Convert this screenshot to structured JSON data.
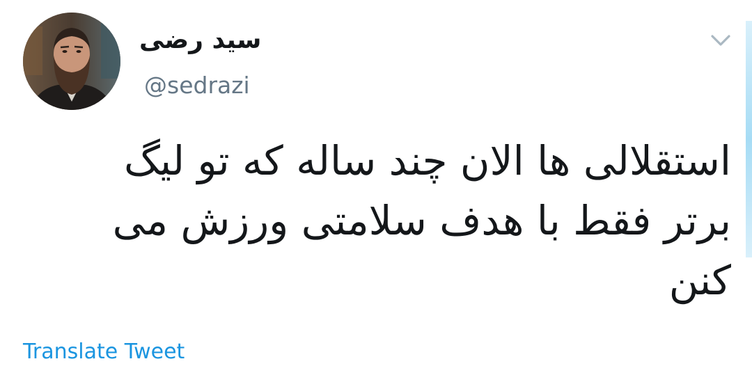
{
  "tweet": {
    "author": {
      "display_name": "سید رضی",
      "handle": "@sedrazi",
      "avatar_icon": "profile-photo"
    },
    "menu_icon": "chevron-down-icon",
    "text": "استقلالی ها الان چند ساله که تو لیگ برتر فقط با هدف سلامتی ورزش می کنن",
    "translate_label": "Translate Tweet"
  },
  "colors": {
    "text": "#14171a",
    "secondary": "#657786",
    "link": "#1b95e0",
    "caret": "#aab8c2"
  }
}
